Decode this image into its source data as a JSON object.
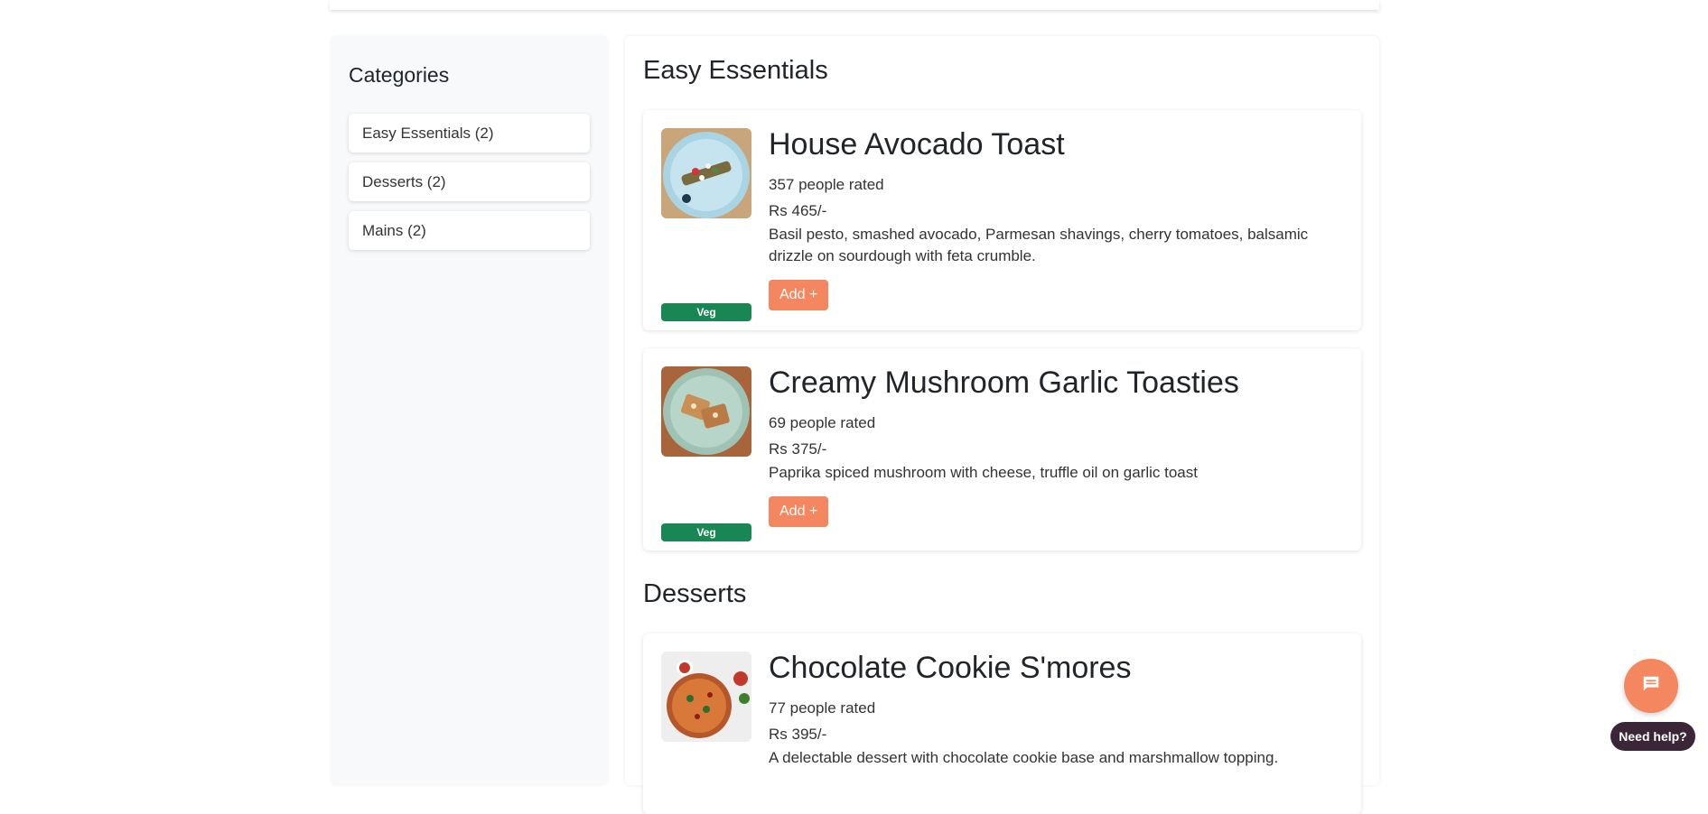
{
  "sidebar": {
    "title": "Categories",
    "items": [
      {
        "label": "Easy Essentials (2)"
      },
      {
        "label": "Desserts (2)"
      },
      {
        "label": "Mains (2)"
      }
    ]
  },
  "sections": [
    {
      "title": "Easy Essentials",
      "items": [
        {
          "name": "House Avocado Toast",
          "rating": "357 people rated",
          "price": "Rs 465/-",
          "description": "Basil pesto, smashed avocado, Parmesan shavings, cherry tomatoes, balsamic drizzle on sourdough with feta crumble.",
          "badge": "Veg",
          "add_label": "Add +"
        },
        {
          "name": "Creamy Mushroom Garlic Toasties",
          "rating": "69 people rated",
          "price": "Rs 375/-",
          "description": "Paprika spiced mushroom with cheese, truffle oil on garlic toast",
          "badge": "Veg",
          "add_label": "Add +"
        }
      ]
    },
    {
      "title": "Desserts",
      "items": [
        {
          "name": "Chocolate Cookie S'mores",
          "rating": "77 people rated",
          "price": "Rs 395/-",
          "description": "A delectable dessert with chocolate cookie base and marshmallow topping."
        }
      ]
    }
  ],
  "help": {
    "label": "Need help?",
    "icon": "chat-icon"
  },
  "colors": {
    "accent": "#f4875f",
    "veg_badge": "#198754",
    "help_pill": "#3b2637"
  }
}
